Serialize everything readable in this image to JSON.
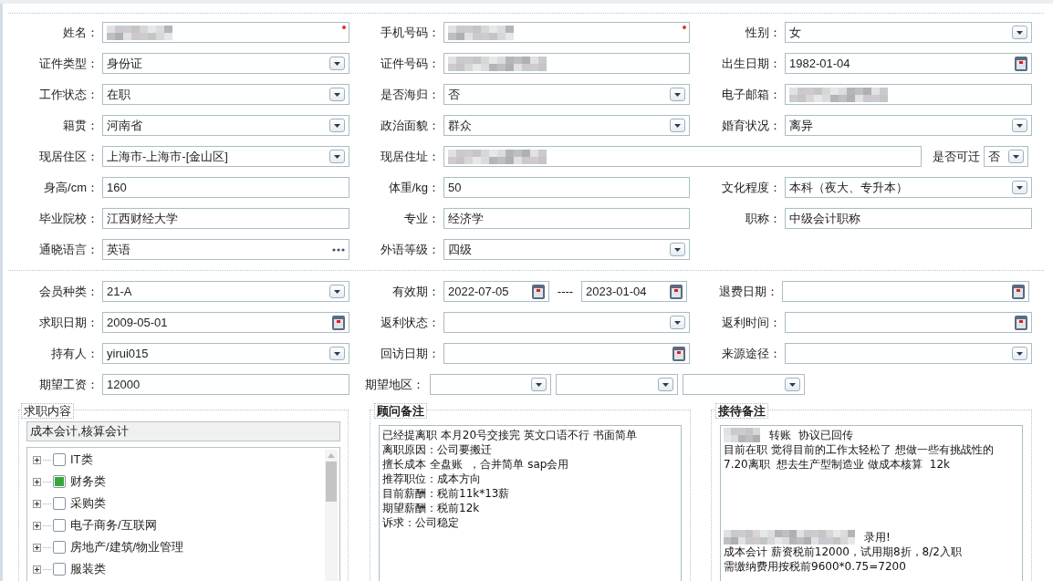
{
  "profile_rows": [
    [
      {
        "label": "姓名：",
        "kind": "text",
        "redacted": true,
        "required": true
      },
      {
        "label": "手机号码：",
        "kind": "text",
        "redacted": true,
        "required": true
      },
      {
        "label": "性别：",
        "kind": "select",
        "value": "女"
      }
    ],
    [
      {
        "label": "证件类型：",
        "kind": "select",
        "value": "身份证"
      },
      {
        "label": "证件号码：",
        "kind": "text",
        "redacted": true
      },
      {
        "label": "出生日期：",
        "kind": "date",
        "value": "1982-01-04"
      }
    ],
    [
      {
        "label": "工作状态：",
        "kind": "select",
        "value": "在职"
      },
      {
        "label": "是否海归：",
        "kind": "select",
        "value": "否"
      },
      {
        "label": "电子邮箱：",
        "kind": "text",
        "redacted": true
      }
    ],
    [
      {
        "label": "籍贯：",
        "kind": "select",
        "value": "河南省"
      },
      {
        "label": "政治面貌：",
        "kind": "select",
        "value": "群众"
      },
      {
        "label": "婚育状况：",
        "kind": "select",
        "value": "离异"
      }
    ],
    [
      {
        "label": "现居住区：",
        "kind": "select",
        "value": "上海市-上海市-[金山区]"
      },
      {
        "label": "现居住址：",
        "kind": "address",
        "redacted": true
      },
      {
        "label": "是否可迁",
        "kind": "inline_select",
        "value": "否"
      }
    ],
    [
      {
        "label": "身高/cm：",
        "kind": "text",
        "value": "160"
      },
      {
        "label": "体重/kg：",
        "kind": "text",
        "value": "50"
      },
      {
        "label": "文化程度：",
        "kind": "select",
        "value": "本科（夜大、专升本）"
      }
    ],
    [
      {
        "label": "毕业院校：",
        "kind": "text",
        "value": "江西财经大学"
      },
      {
        "label": "专业：",
        "kind": "text",
        "value": "经济学"
      },
      {
        "label": "职称：",
        "kind": "text",
        "value": "中级会计职称"
      }
    ],
    [
      {
        "label": "通晓语言：",
        "kind": "lookup",
        "value": "英语"
      },
      {
        "label": "外语等级：",
        "kind": "select",
        "value": "四级"
      }
    ]
  ],
  "membership_rows": [
    [
      {
        "label": "会员种类：",
        "kind": "select",
        "value": "21-A"
      },
      {
        "label": "有效期：",
        "kind": "date_range",
        "from": "2022-07-05",
        "separator": "----",
        "to": "2023-01-04"
      },
      {
        "label": "退费日期：",
        "kind": "date"
      }
    ],
    [
      {
        "label": "求职日期：",
        "kind": "date",
        "value": "2009-05-01"
      },
      {
        "label": "返利状态：",
        "kind": "select"
      },
      {
        "label": "返利时间：",
        "kind": "date"
      }
    ],
    [
      {
        "label": "持有人：",
        "kind": "select",
        "value": "yirui015"
      },
      {
        "label": "回访日期：",
        "kind": "date"
      },
      {
        "label": "来源途径：",
        "kind": "select"
      }
    ],
    [
      {
        "label": "期望工资：",
        "kind": "text",
        "value": "12000"
      },
      {
        "label": "期望地区：",
        "kind": "region",
        "selects": [
          {
            "kind": "select"
          },
          {
            "kind": "select"
          },
          {
            "kind": "select"
          }
        ]
      }
    ]
  ],
  "job_content": {
    "legend": "求职内容",
    "summary": "成本会计,核算会计",
    "categories": [
      {
        "label": "IT类",
        "checked": false
      },
      {
        "label": "财务类",
        "checked": true
      },
      {
        "label": "采购类",
        "checked": false
      },
      {
        "label": "电子商务/互联网",
        "checked": false
      },
      {
        "label": "房地产/建筑/物业管理",
        "checked": false
      },
      {
        "label": "服装类",
        "checked": false
      }
    ]
  },
  "notes": [
    {
      "legend": "顾问备注",
      "paragraphs": [
        [
          {
            "text": "已经提离职 本月20号交接完 英文口语不行 书面简单",
            "redacted": false
          },
          {
            "text": "离职原因：公司要搬迁",
            "redacted": false
          },
          {
            "text": "擅长成本 全盘账  ，合并简单 sap会用",
            "redacted": false
          },
          {
            "text": "推荐职位：成本方向",
            "redacted": false
          },
          {
            "text": "目前薪酬：税前11k*13薪",
            "redacted": false
          },
          {
            "text": "期望薪酬：税前12k",
            "redacted": false
          },
          {
            "text": "诉求：公司稳定",
            "redacted": false
          }
        ]
      ]
    },
    {
      "legend": "接待备注",
      "paragraphs": [
        [
          {
            "text": "转账  协议已回传",
            "redacted": true
          },
          {
            "text": "目前在职 觉得目前的工作太轻松了 想做一些有挑战性的 7.20离职  想去生产型制造业 做成本核算  12k",
            "redacted": false
          }
        ],
        [
          {
            "text": "录用!",
            "redacted": true
          },
          {
            "text": "成本会计 薪资税前12000，试用期8折，8/2入职",
            "redacted": false
          },
          {
            "text": "需缴纳费用按税前9600*0.75=7200",
            "redacted": false
          }
        ]
      ]
    }
  ]
}
